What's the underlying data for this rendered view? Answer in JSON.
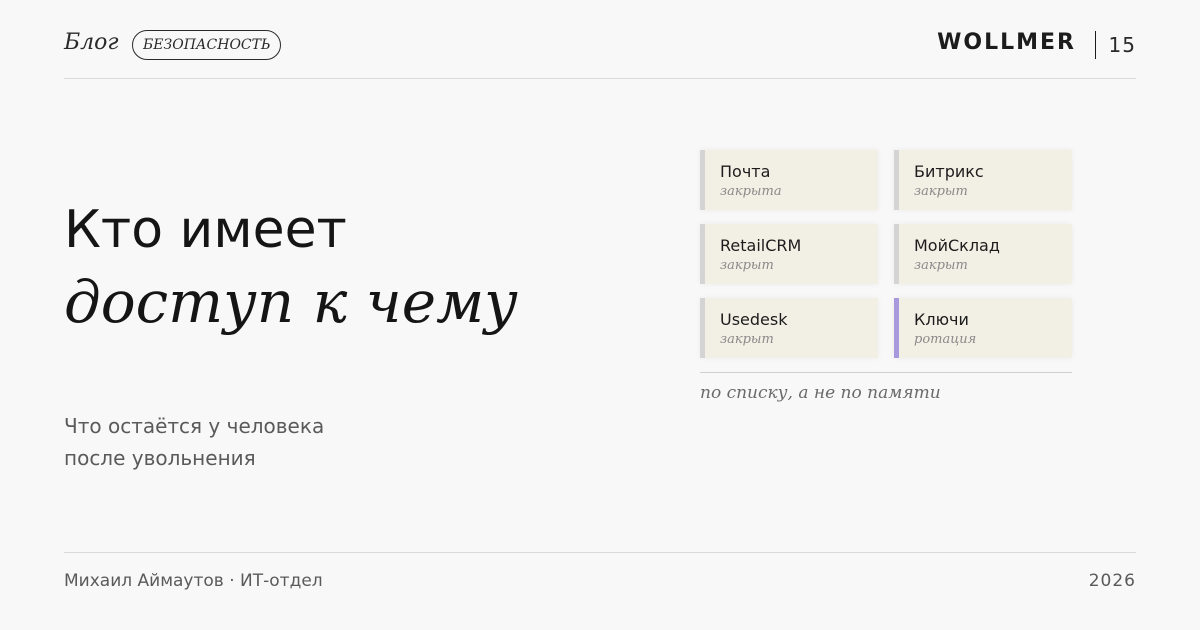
{
  "header": {
    "section": "Блог",
    "tag": "БЕЗОПАСНОСТЬ",
    "logo": "WOLLMER",
    "page_number": "15"
  },
  "hero": {
    "title_line1": "Кто имеет",
    "title_line2": "доступ к чему",
    "subtitle_line1": "Что остаётся у человека",
    "subtitle_line2": "после увольнения"
  },
  "access_cards": [
    {
      "name": "Почта",
      "status": "закрыта",
      "accent": false
    },
    {
      "name": "Битрикс",
      "status": "закрыт",
      "accent": false
    },
    {
      "name": "RetailCRM",
      "status": "закрыт",
      "accent": false
    },
    {
      "name": "МойСклад",
      "status": "закрыт",
      "accent": false
    },
    {
      "name": "Usedesk",
      "status": "закрыт",
      "accent": false
    },
    {
      "name": "Ключи",
      "status": "ротация",
      "accent": true
    }
  ],
  "cards_note": "по списку, а не по памяти",
  "footer": {
    "author": "Михаил Аймаутов · ИТ-отдел",
    "year": "2026"
  },
  "colors": {
    "background": "#f8f8f8",
    "card_background": "#f2efe4",
    "card_border": "#d4d4d4",
    "accent_border": "#a899dd"
  }
}
